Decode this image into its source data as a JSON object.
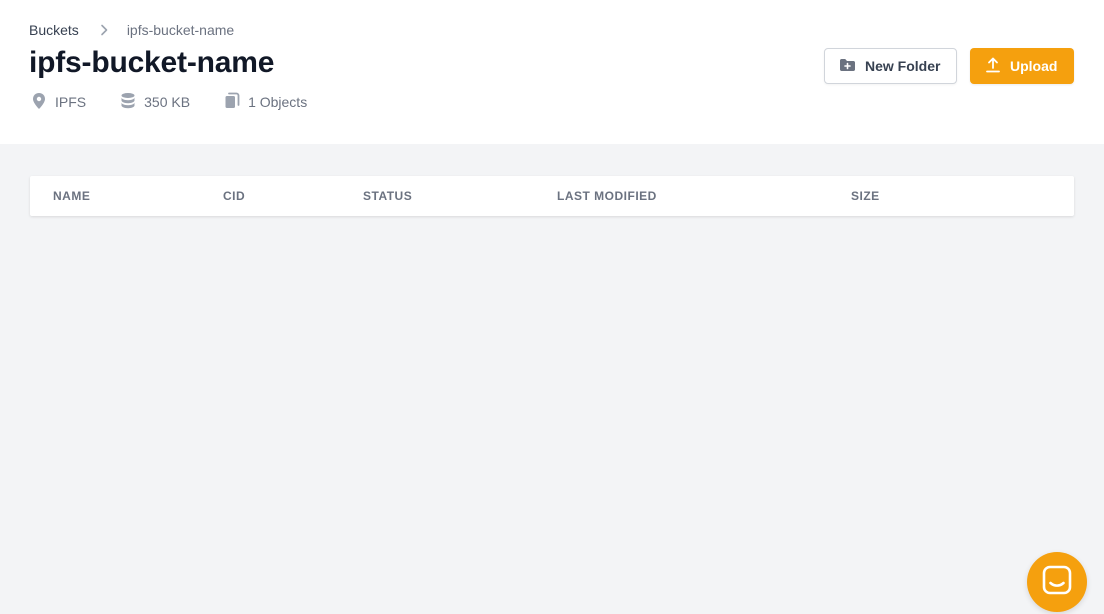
{
  "breadcrumb": {
    "parent": "Buckets",
    "current": "ipfs-bucket-name",
    "separator_icon": "chevron-right-icon"
  },
  "bucket": {
    "name": "ipfs-bucket-name",
    "location": "IPFS",
    "size": "350 KB",
    "objects": "1 Objects",
    "location_icon": "map-pin-icon",
    "size_icon": "database-icon",
    "objects_icon": "documents-icon"
  },
  "actions": {
    "new_folder_label": "New Folder",
    "new_folder_icon": "folder-plus-icon",
    "upload_label": "Upload",
    "upload_icon": "upload-icon"
  },
  "table": {
    "columns": [
      "NAME",
      "CID",
      "STATUS",
      "LAST MODIFIED",
      "SIZE"
    ],
    "rows": []
  },
  "chat": {
    "icon": "chat-icon"
  },
  "colors": {
    "accent": "#f5a00e",
    "background": "#f3f4f6",
    "header_bg": "#ffffff",
    "title": "#111827",
    "muted_text": "#6b7280"
  }
}
